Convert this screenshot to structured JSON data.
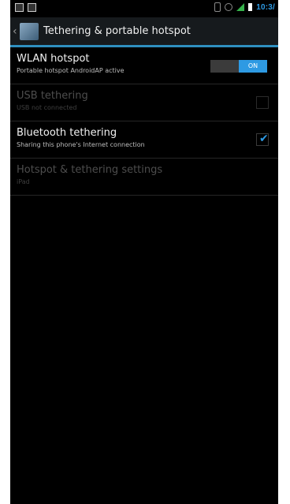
{
  "status_bar": {
    "time": "10:3/",
    "icons": [
      "notification-icon",
      "gallery-icon",
      "bluetooth-icon",
      "alarm-icon",
      "signal-icon",
      "battery-icon"
    ]
  },
  "action_bar": {
    "title": "Tethering & portable hotspot",
    "back_glyph": "‹"
  },
  "settings": [
    {
      "title": "WLAN hotspot",
      "summary": "Portable hotspot AndroidAP active",
      "control": "toggle",
      "state": "ON",
      "enabled": true
    },
    {
      "title": "USB tethering",
      "summary": "USB not connected",
      "control": "checkbox",
      "checked": false,
      "enabled": false
    },
    {
      "title": "Bluetooth tethering",
      "summary": "Sharing this phone's Internet connection",
      "control": "checkbox",
      "checked": true,
      "enabled": true
    },
    {
      "title": "Hotspot & tethering settings",
      "summary": "iPad",
      "control": "none",
      "enabled": false
    }
  ],
  "colors": {
    "accent": "#2e9ae3",
    "background": "#000000",
    "action_bar": "#161a1d"
  }
}
